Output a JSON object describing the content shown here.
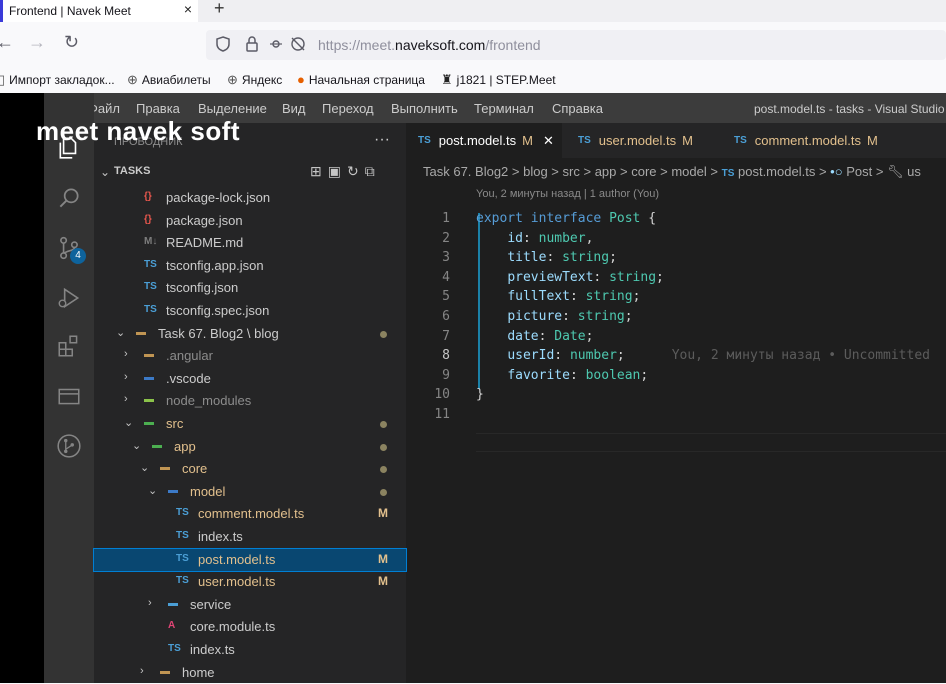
{
  "browser": {
    "tab_title": "Frontend | Navek Meet",
    "tab_close": "×",
    "new_tab": "+",
    "back": "←",
    "forward": "→",
    "reload": "↻",
    "url_prefix": "https://meet.",
    "url_domain": "naveksoft.com",
    "url_path": "/frontend"
  },
  "bookmarks": [
    {
      "label": "Импорт закладок...",
      "icon": "import-icon"
    },
    {
      "label": "Авиабилеты",
      "icon": "globe-icon"
    },
    {
      "label": "Яндекс",
      "icon": "globe-icon"
    },
    {
      "label": "Начальная страница",
      "icon": "firefox-icon"
    },
    {
      "label": "j1821 | STEP.Meet",
      "icon": "meet-icon"
    }
  ],
  "watermark": "meet  navek soft",
  "vscode": {
    "menu": [
      "Файл",
      "Правка",
      "Выделение",
      "Вид",
      "Переход",
      "Выполнить",
      "Терминал",
      "Справка"
    ],
    "window_title": "post.model.ts - tasks - Visual Studio",
    "scm_badge": "4",
    "sidebar_header": "ПРОВОДНИК",
    "sidebar_more": "···",
    "tasks_label": "TASKS",
    "tree": [
      {
        "label": "package-lock.json",
        "icon": "{}",
        "icon_color": "#e8574d",
        "indent": 1,
        "arrow": "",
        "status": "",
        "dot": false
      },
      {
        "label": "package.json",
        "icon": "{}",
        "icon_color": "#e8574d",
        "indent": 1,
        "arrow": "",
        "status": "",
        "dot": false
      },
      {
        "label": "README.md",
        "icon": "M↓",
        "icon_color": "#7d7d7d",
        "indent": 1,
        "arrow": "",
        "status": "",
        "dot": false
      },
      {
        "label": "tsconfig.app.json",
        "icon": "TS",
        "icon_color": "#4b9fd6",
        "indent": 1,
        "arrow": "",
        "status": "",
        "dot": false
      },
      {
        "label": "tsconfig.json",
        "icon": "TS",
        "icon_color": "#4b9fd6",
        "indent": 1,
        "arrow": "",
        "status": "",
        "dot": false
      },
      {
        "label": "tsconfig.spec.json",
        "icon": "TS",
        "icon_color": "#4b9fd6",
        "indent": 1,
        "arrow": "",
        "status": "",
        "dot": false
      },
      {
        "label": "Task 67. Blog2 \\ blog",
        "icon": "▬",
        "icon_color": "#c09553",
        "indent": 0,
        "arrow": "⌄",
        "status": "",
        "dot": true
      },
      {
        "label": ".angular",
        "icon": "▬",
        "icon_color": "#c09553",
        "indent": 1,
        "arrow": "›",
        "status": "",
        "dot": false,
        "muted": true
      },
      {
        "label": ".vscode",
        "icon": "▬",
        "icon_color": "#3c7ac7",
        "indent": 1,
        "arrow": "›",
        "status": "",
        "dot": false
      },
      {
        "label": "node_modules",
        "icon": "▬",
        "icon_color": "#8bc34a",
        "indent": 1,
        "arrow": "›",
        "status": "",
        "dot": false,
        "muted": true
      },
      {
        "label": "src",
        "icon": "▬",
        "icon_color": "#4caf50",
        "indent": 1,
        "arrow": "⌄",
        "status": "",
        "dot": true,
        "yellow": true
      },
      {
        "label": "app",
        "icon": "▬",
        "icon_color": "#4caf50",
        "indent": 2,
        "arrow": "⌄",
        "status": "",
        "dot": true,
        "yellow": true
      },
      {
        "label": "core",
        "icon": "▬",
        "icon_color": "#c09553",
        "indent": 3,
        "arrow": "⌄",
        "status": "",
        "dot": true,
        "yellow": true
      },
      {
        "label": "model",
        "icon": "▬",
        "icon_color": "#3c7ac7",
        "indent": 4,
        "arrow": "⌄",
        "status": "",
        "dot": true,
        "yellow": true
      },
      {
        "label": "comment.model.ts",
        "icon": "TS",
        "icon_color": "#4b9fd6",
        "indent": 5,
        "arrow": "",
        "status": "M",
        "dot": false,
        "yellow": true
      },
      {
        "label": "index.ts",
        "icon": "TS",
        "icon_color": "#4b9fd6",
        "indent": 5,
        "arrow": "",
        "status": "",
        "dot": false
      },
      {
        "label": "post.model.ts",
        "icon": "TS",
        "icon_color": "#4b9fd6",
        "indent": 5,
        "arrow": "",
        "status": "M",
        "dot": false,
        "selected": true,
        "yellow": true
      },
      {
        "label": "user.model.ts",
        "icon": "TS",
        "icon_color": "#4b9fd6",
        "indent": 5,
        "arrow": "",
        "status": "M",
        "dot": false,
        "yellow": true
      },
      {
        "label": "service",
        "icon": "▬",
        "icon_color": "#4b9fd6",
        "indent": 4,
        "arrow": "›",
        "status": "",
        "dot": false
      },
      {
        "label": "core.module.ts",
        "icon": "A",
        "icon_color": "#e04575",
        "indent": 4,
        "arrow": "",
        "status": "",
        "dot": false
      },
      {
        "label": "index.ts",
        "icon": "TS",
        "icon_color": "#4b9fd6",
        "indent": 4,
        "arrow": "",
        "status": "",
        "dot": false
      },
      {
        "label": "home",
        "icon": "▬",
        "icon_color": "#c09553",
        "indent": 3,
        "arrow": "›",
        "status": "",
        "dot": false
      }
    ],
    "tabs": [
      {
        "label": "post.model.ts",
        "mod": "M",
        "active": true,
        "close": "✕"
      },
      {
        "label": "user.model.ts",
        "mod": "M",
        "active": false
      },
      {
        "label": "comment.model.ts",
        "mod": "M",
        "active": false
      }
    ],
    "breadcrumbs": [
      "Task 67. Blog2",
      "blog",
      "src",
      "app",
      "core",
      "model",
      "post.model.ts",
      "Post",
      "us"
    ],
    "blame": "You, 2 минуты назад | 1 author (You)",
    "code_lines": [
      {
        "n": "1",
        "html": "<span class='kw'>export</span> <span class='kw'>interface</span> <span class='ty'>Post</span> {"
      },
      {
        "n": "2",
        "html": "    <span class='pr'>id</span>: <span class='ty'>number</span>,"
      },
      {
        "n": "3",
        "html": "    <span class='pr'>title</span>: <span class='ty'>string</span>;"
      },
      {
        "n": "4",
        "html": "    <span class='pr'>previewText</span>: <span class='ty'>string</span>;"
      },
      {
        "n": "5",
        "html": "    <span class='pr'>fullText</span>: <span class='ty'>string</span>;"
      },
      {
        "n": "6",
        "html": "    <span class='pr'>picture</span>: <span class='ty'>string</span>;"
      },
      {
        "n": "7",
        "html": "    <span class='pr'>date</span>: <span class='ty'>Date</span>;"
      },
      {
        "n": "8",
        "html": "    <span class='pr'>userId</span>: <span class='ty'>number</span>;      <span class='ghost'>You, 2 минуты назад • Uncommitted</span>"
      },
      {
        "n": "9",
        "html": "    <span class='pr'>favorite</span>: <span class='ty'>boolean</span>;"
      },
      {
        "n": "10",
        "html": "}"
      },
      {
        "n": "11",
        "html": ""
      }
    ],
    "current_line": "8"
  }
}
